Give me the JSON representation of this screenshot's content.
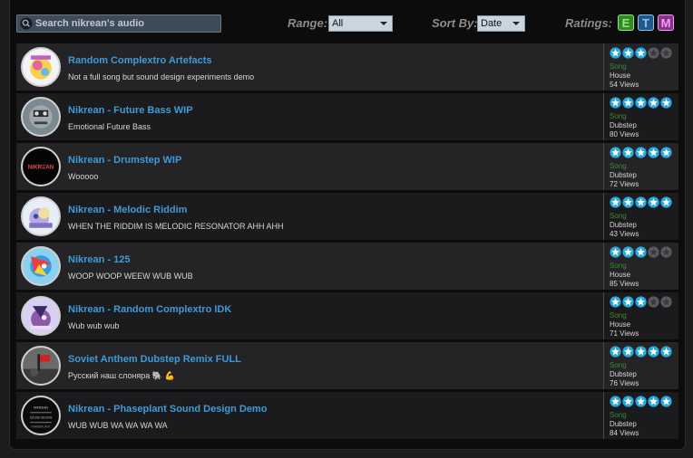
{
  "search": {
    "placeholder": "Search nikrean's audio",
    "value": ""
  },
  "filters": {
    "range_label": "Range:",
    "range_value": "All",
    "sort_label": "Sort By:",
    "sort_value": "Date",
    "ratings_label": "Ratings:",
    "ratings": [
      {
        "letter": "E",
        "color": "#2f8a1f",
        "text_color": "#9ee08a"
      },
      {
        "letter": "T",
        "color": "#1f5a8a",
        "text_color": "#8ac4f0"
      },
      {
        "letter": "M",
        "color": "#8a2f8a",
        "text_color": "#f0a0f0"
      }
    ]
  },
  "colors": {
    "accent": "#3f9ad8",
    "type_green": "#3c8a30",
    "star_on": "#2aa9e0",
    "star_off": "#5a5a5e"
  },
  "tracks": [
    {
      "title": "Random Complextro Artefacts",
      "description": "Not a full song but sound design experiments demo",
      "stars": 3,
      "type": "Song",
      "genre": "House",
      "views": "54 Views"
    },
    {
      "title": "Nikrean - Future Bass WIP",
      "description": "Emotional Future Bass",
      "stars": 5,
      "type": "Song",
      "genre": "Dubstep",
      "views": "80 Views"
    },
    {
      "title": "Nikrean - Drumstep WIP",
      "description": "Wooooo",
      "stars": 5,
      "type": "Song",
      "genre": "Dubstep",
      "views": "72 Views"
    },
    {
      "title": "Nikrean - Melodic Riddim",
      "description": "WHEN THE RIDDIM IS MELODIC RESONATOR AHH AHH",
      "stars": 5,
      "type": "Song",
      "genre": "Dubstep",
      "views": "43 Views"
    },
    {
      "title": "Nikrean - 125",
      "description": "WOOP WOOP WEEW WUB WUB",
      "stars": 3,
      "type": "Song",
      "genre": "House",
      "views": "85 Views"
    },
    {
      "title": "Nikrean - Random Complextro IDK",
      "description": "Wub wub wub",
      "stars": 3,
      "type": "Song",
      "genre": "House",
      "views": "71 Views"
    },
    {
      "title": "Soviet Anthem Dubstep Remix FULL",
      "description": "Русский наш слоняра 🐘 💪",
      "stars": 5,
      "type": "Song",
      "genre": "Dubstep",
      "views": "76 Views"
    },
    {
      "title": "Nikrean - Phaseplant Sound Design Demo",
      "description": "WUB WUB WA WA WA WA",
      "stars": 5,
      "type": "Song",
      "genre": "Dubstep",
      "views": "84 Views"
    }
  ]
}
